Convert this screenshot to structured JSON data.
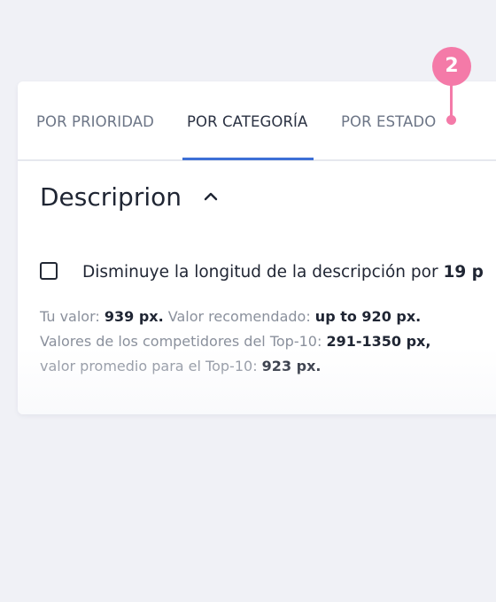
{
  "tabs": [
    {
      "label": "POR PRIORIDAD",
      "active": false
    },
    {
      "label": "POR CATEGORÍA",
      "active": true
    },
    {
      "label": "POR ESTADO",
      "active": false
    }
  ],
  "marker": {
    "number": "2",
    "color": "#f47aa8"
  },
  "section": {
    "title": "Descriprion",
    "chevron_icon": "chevron-up-icon"
  },
  "issue": {
    "checked": false,
    "text": "Disminuye la longitud de la descripción por ",
    "amount": "19 p"
  },
  "details": {
    "your_value_label": "Tu valor: ",
    "your_value": "939 px.",
    "recommended_label": " Valor recomendado: ",
    "recommended_value": "up to 920 px.",
    "competitors_label": "Valores de los competidores del Top-10: ",
    "competitors_value": "291-1350 px,",
    "average_label": "valor promedio para el Top-10: ",
    "average_value": "923 px."
  },
  "colors": {
    "accent": "#3d6fd6",
    "marker": "#f47aa8",
    "background": "#f0f1f6"
  }
}
